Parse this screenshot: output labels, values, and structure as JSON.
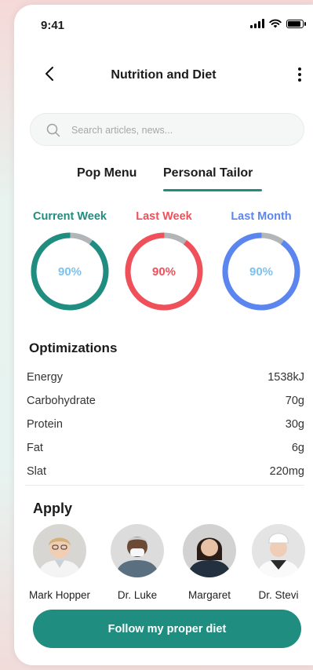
{
  "status_bar": {
    "time": "9:41"
  },
  "header": {
    "title": "Nutrition and Diet"
  },
  "search": {
    "placeholder": "Search articles, news..."
  },
  "tabs": [
    {
      "label": "Pop Menu",
      "active": false
    },
    {
      "label": "Personal Tailor",
      "active": true
    }
  ],
  "progress": [
    {
      "label": "Current Week",
      "value": "90%",
      "fraction": 0.9,
      "color": "#1f8d7f",
      "label_color": "#1f8d7f",
      "value_color": "#7bc2ef"
    },
    {
      "label": "Last Week",
      "value": "90%",
      "fraction": 0.9,
      "color": "#f0505a",
      "label_color": "#f0505a",
      "value_color": "#f0505a"
    },
    {
      "label": "Last Month",
      "value": "90%",
      "fraction": 0.9,
      "color": "#5b86f0",
      "label_color": "#5b86f0",
      "value_color": "#7bc2ef"
    }
  ],
  "optimizations": {
    "title": "Optimizations",
    "rows": [
      {
        "name": "Energy",
        "value": "1538kJ"
      },
      {
        "name": "Carbohydrate",
        "value": "70g"
      },
      {
        "name": "Protein",
        "value": "30g"
      },
      {
        "name": "Fat",
        "value": "6g"
      },
      {
        "name": "Slat",
        "value": "220mg"
      }
    ]
  },
  "apply": {
    "title": "Apply",
    "people": [
      {
        "name": "Mark Hopper"
      },
      {
        "name": "Dr. Luke"
      },
      {
        "name": "Margaret"
      },
      {
        "name": "Dr. Stevi"
      }
    ]
  },
  "cta": {
    "label": "Follow my proper diet"
  },
  "colors": {
    "accent": "#1f8d7f",
    "track": "#b3b6b9"
  }
}
